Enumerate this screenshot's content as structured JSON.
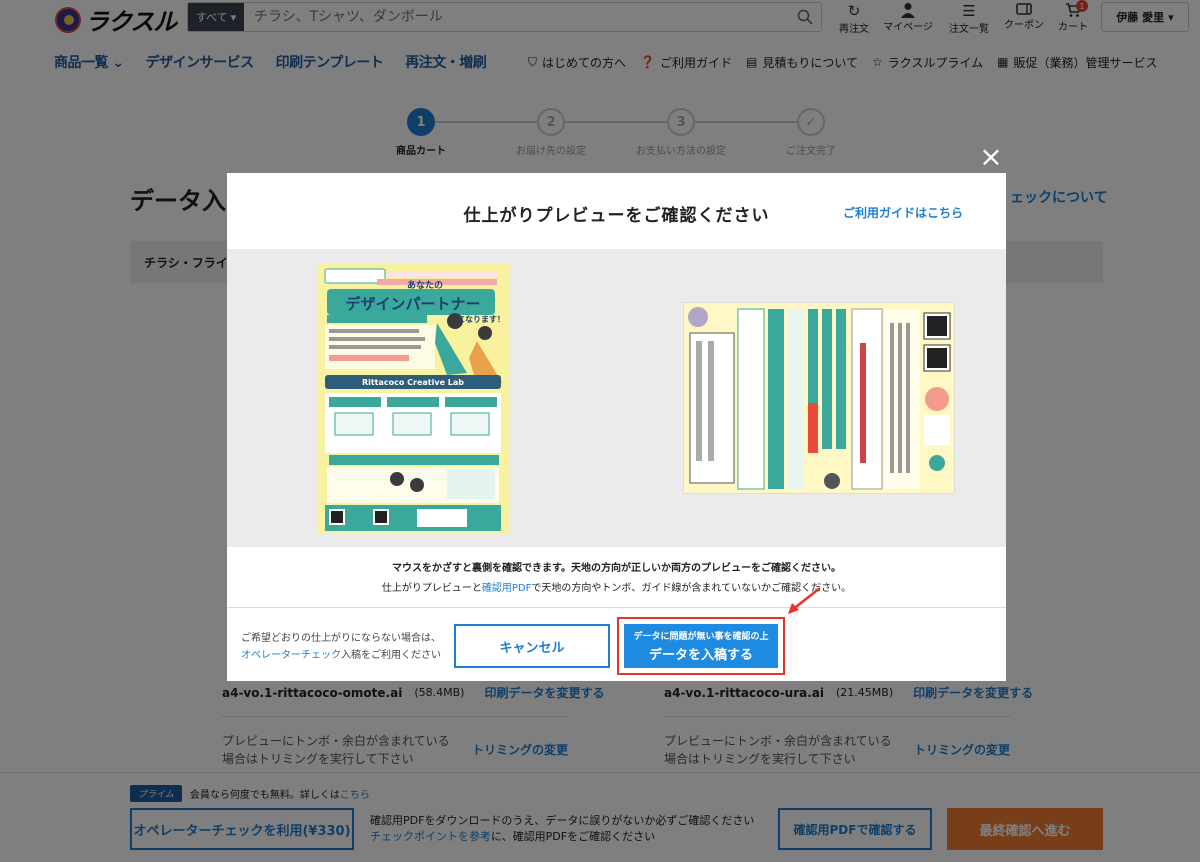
{
  "header": {
    "logo_text": "ラクスル",
    "search_category": "すべて",
    "search_placeholder": "チラシ、Tシャツ、ダンボール",
    "tools": [
      {
        "label": "再注文",
        "icon": "reload-icon"
      },
      {
        "label": "マイページ",
        "icon": "person-icon"
      },
      {
        "label": "注文一覧",
        "icon": "list-icon"
      },
      {
        "label": "クーポン",
        "icon": "coupon-icon"
      },
      {
        "label": "カート",
        "icon": "cart-icon",
        "badge": "1"
      }
    ],
    "user_name": "伊藤 愛里"
  },
  "nav": {
    "main": [
      "商品一覧",
      "デザインサービス",
      "印刷テンプレート",
      "再注文・増刷"
    ],
    "sub": [
      {
        "label": "はじめての方へ",
        "icon": "shield-icon"
      },
      {
        "label": "ご利用ガイド",
        "icon": "question-icon"
      },
      {
        "label": "見積もりについて",
        "icon": "document-icon"
      },
      {
        "label": "ラクスルプライム",
        "icon": "star-icon"
      },
      {
        "label": "販促（業務）管理サービス",
        "icon": "building-icon"
      }
    ]
  },
  "steps": [
    {
      "num": "1",
      "label": "商品カート",
      "active": true
    },
    {
      "num": "2",
      "label": "お届け先の設定",
      "active": false
    },
    {
      "num": "3",
      "label": "お支払い方法の設定",
      "active": false
    },
    {
      "num": "✓",
      "label": "ご注文完了",
      "active": false
    }
  ],
  "page": {
    "title": "データ入",
    "operator_link": "ェックについて",
    "product_bar": "チラシ・フライ",
    "files": [
      {
        "name": "a4-vo.1-rittacoco-omote.ai",
        "size": "(58.4MB)",
        "change": "印刷データを変更する"
      },
      {
        "name": "a4-vo.1-rittacoco-ura.ai",
        "size": "(21.45MB)",
        "change": "印刷データを変更する"
      }
    ],
    "trim_text": [
      "プレビューにトンボ・余白が含まれている",
      "場合はトリミングを実行して下さい"
    ],
    "trim_link": "トリミングの変更"
  },
  "bottom": {
    "prime_badge": "プライム",
    "prime_text": "会員なら何度でも無料。詳しくは",
    "prime_link": "こちら",
    "operator_button": "オペレーターチェックを利用(¥330)",
    "note_line1": "確認用PDFをダウンロードのうえ、データに誤りがないか必ずご確認ください",
    "note_link": "チェックポイントを参考",
    "note_line2_rest": "に、確認用PDFをご確認ください",
    "pdf_button": "確認用PDFで確認する",
    "final_button": "最終確認へ進む"
  },
  "modal": {
    "title": "仕上がりプレビューをご確認ください",
    "guide_link": "ご利用ガイドはこちら",
    "front_preview": {
      "headline": "デザインパートナー",
      "sub": "あなたの",
      "tag": "になります！",
      "footer": "Rittacoco Creative Lab"
    },
    "note_bold": "マウスをかざすと裏側を確認できます。天地の方向が正しいか両方のプレビューをご確認ください。",
    "note2_pre": "仕上がりプレビューと",
    "note2_link": "確認用PDF",
    "note2_post": "で天地の方向やトンボ、ガイド線が含まれていないかご確認ください。",
    "foot_text1": "ご希望どおりの仕上がりにならない場合は、",
    "foot_link": "オペレーターチェック",
    "foot_text2": "入稿をご利用ください",
    "close": "×",
    "cancel": "キャンセル",
    "submit_small": "データに問題が無い事を確認の上",
    "submit_main": "データを入稿する"
  },
  "colors": {
    "brand_blue": "#1e7fd0",
    "nav_blue": "#1e5aa0",
    "highlight_red": "#e8332a",
    "final_orange": "#f07c35",
    "flyer_yellow": "#f8f2a0",
    "flyer_teal": "#3aa89a"
  }
}
